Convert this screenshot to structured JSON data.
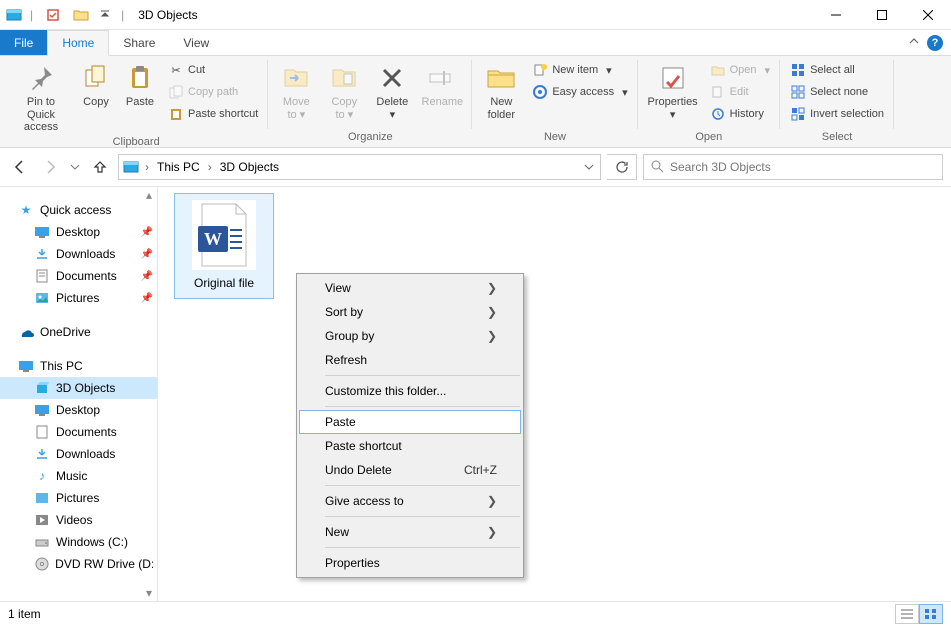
{
  "window": {
    "title": "3D Objects",
    "min": "—",
    "max": "□",
    "close": "✕"
  },
  "tabs": {
    "file": "File",
    "home": "Home",
    "share": "Share",
    "view": "View"
  },
  "ribbon": {
    "clipboard": {
      "label": "Clipboard",
      "pin": "Pin to Quick access",
      "copy": "Copy",
      "paste": "Paste",
      "cut": "Cut",
      "copy_path": "Copy path",
      "paste_shortcut": "Paste shortcut"
    },
    "organize": {
      "label": "Organize",
      "move_to": "Move to",
      "copy_to": "Copy to",
      "delete": "Delete",
      "rename": "Rename"
    },
    "new": {
      "label": "New",
      "new_folder": "New folder",
      "new_item": "New item",
      "easy_access": "Easy access"
    },
    "open": {
      "label": "Open",
      "properties": "Properties",
      "open": "Open",
      "edit": "Edit",
      "history": "History"
    },
    "select": {
      "label": "Select",
      "select_all": "Select all",
      "select_none": "Select none",
      "invert": "Invert selection"
    }
  },
  "breadcrumb": {
    "root": "This PC",
    "current": "3D Objects"
  },
  "search": {
    "placeholder": "Search 3D Objects"
  },
  "tree": {
    "quick_access": "Quick access",
    "desktop": "Desktop",
    "downloads": "Downloads",
    "documents": "Documents",
    "pictures": "Pictures",
    "onedrive": "OneDrive",
    "this_pc": "This PC",
    "3d_objects": "3D Objects",
    "pc_desktop": "Desktop",
    "pc_documents": "Documents",
    "pc_downloads": "Downloads",
    "music": "Music",
    "pc_pictures": "Pictures",
    "videos": "Videos",
    "windows_c": "Windows  (C:)",
    "dvd": "DVD RW Drive (D:)"
  },
  "files": {
    "item0": "Original file"
  },
  "context_menu": {
    "view": "View",
    "sort_by": "Sort by",
    "group_by": "Group by",
    "refresh": "Refresh",
    "customize": "Customize this folder...",
    "paste": "Paste",
    "paste_shortcut": "Paste shortcut",
    "undo_delete": "Undo Delete",
    "undo_delete_shortcut": "Ctrl+Z",
    "give_access": "Give access to",
    "new": "New",
    "properties": "Properties"
  },
  "status": {
    "count": "1 item"
  }
}
